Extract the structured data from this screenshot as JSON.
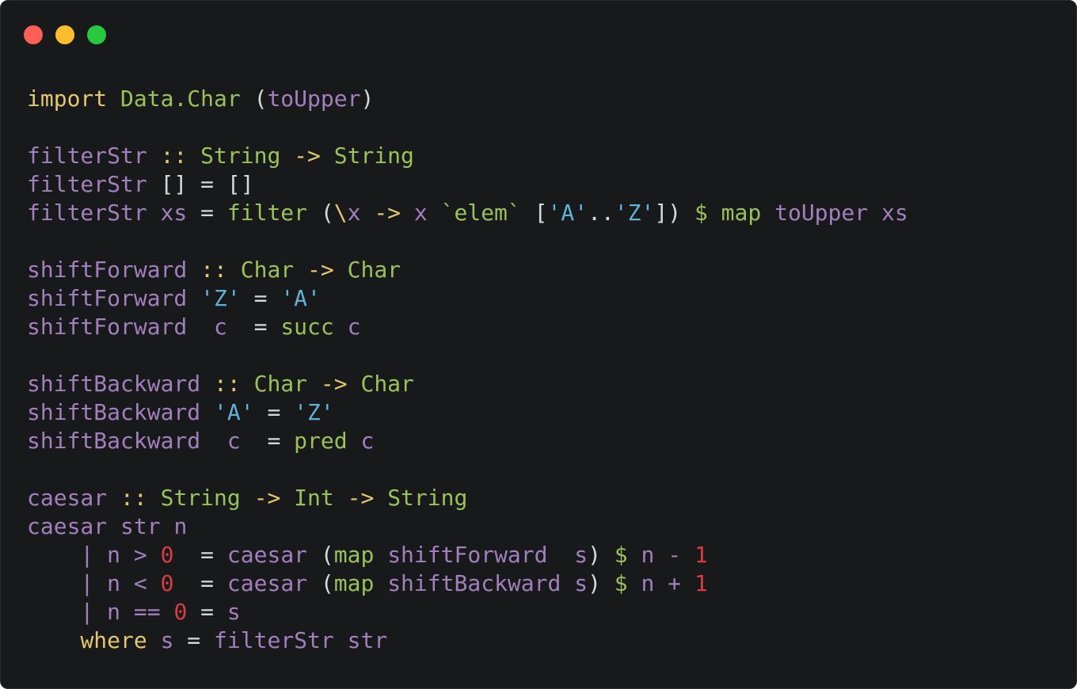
{
  "window": {
    "controls": [
      "close",
      "minimize",
      "maximize"
    ],
    "colors": {
      "background": "#18191b",
      "close": "#ff5f56",
      "minimize": "#ffbd2e",
      "maximize": "#27c93f"
    }
  },
  "syntax_colors": {
    "text": "#d8d8d8",
    "function": "#a27fbd",
    "type": "#9bc15a",
    "keyword": "#e5c770",
    "string": "#5fb3d6",
    "number": "#d83c44"
  },
  "code": {
    "language": "haskell",
    "lines": [
      [
        [
          "kw",
          "import"
        ],
        [
          "text",
          " "
        ],
        [
          "type",
          "Data.Char"
        ],
        [
          "text",
          " ("
        ],
        [
          "fn",
          "toUpper"
        ],
        [
          "text",
          ")"
        ]
      ],
      [],
      [
        [
          "fn",
          "filterStr"
        ],
        [
          "text",
          " "
        ],
        [
          "sym",
          "::"
        ],
        [
          "text",
          " "
        ],
        [
          "type",
          "String"
        ],
        [
          "text",
          " "
        ],
        [
          "sym",
          "->"
        ],
        [
          "text",
          " "
        ],
        [
          "type",
          "String"
        ]
      ],
      [
        [
          "fn",
          "filterStr"
        ],
        [
          "text",
          " [] = []"
        ]
      ],
      [
        [
          "fn",
          "filterStr"
        ],
        [
          "text",
          " "
        ],
        [
          "fn",
          "xs"
        ],
        [
          "text",
          " = "
        ],
        [
          "builtin",
          "filter"
        ],
        [
          "text",
          " ("
        ],
        [
          "sym",
          "\\"
        ],
        [
          "fn",
          "x"
        ],
        [
          "text",
          " "
        ],
        [
          "sym",
          "->"
        ],
        [
          "text",
          " "
        ],
        [
          "fn",
          "x"
        ],
        [
          "text",
          " "
        ],
        [
          "builtin",
          "`elem`"
        ],
        [
          "text",
          " ["
        ],
        [
          "str",
          "'A'"
        ],
        [
          "text",
          ".."
        ],
        [
          "str",
          "'Z'"
        ],
        [
          "text",
          "]) "
        ],
        [
          "builtin",
          "$"
        ],
        [
          "text",
          " "
        ],
        [
          "builtin",
          "map"
        ],
        [
          "text",
          " "
        ],
        [
          "fn",
          "toUpper"
        ],
        [
          "text",
          " "
        ],
        [
          "fn",
          "xs"
        ]
      ],
      [],
      [
        [
          "fn",
          "shiftForward"
        ],
        [
          "text",
          " "
        ],
        [
          "sym",
          "::"
        ],
        [
          "text",
          " "
        ],
        [
          "type",
          "Char"
        ],
        [
          "text",
          " "
        ],
        [
          "sym",
          "->"
        ],
        [
          "text",
          " "
        ],
        [
          "type",
          "Char"
        ]
      ],
      [
        [
          "fn",
          "shiftForward"
        ],
        [
          "text",
          " "
        ],
        [
          "str",
          "'Z'"
        ],
        [
          "text",
          " = "
        ],
        [
          "str",
          "'A'"
        ]
      ],
      [
        [
          "fn",
          "shiftForward"
        ],
        [
          "text",
          "  "
        ],
        [
          "fn",
          "c"
        ],
        [
          "text",
          "  = "
        ],
        [
          "builtin",
          "succ"
        ],
        [
          "text",
          " "
        ],
        [
          "fn",
          "c"
        ]
      ],
      [],
      [
        [
          "fn",
          "shiftBackward"
        ],
        [
          "text",
          " "
        ],
        [
          "sym",
          "::"
        ],
        [
          "text",
          " "
        ],
        [
          "type",
          "Char"
        ],
        [
          "text",
          " "
        ],
        [
          "sym",
          "->"
        ],
        [
          "text",
          " "
        ],
        [
          "type",
          "Char"
        ]
      ],
      [
        [
          "fn",
          "shiftBackward"
        ],
        [
          "text",
          " "
        ],
        [
          "str",
          "'A'"
        ],
        [
          "text",
          " = "
        ],
        [
          "str",
          "'Z'"
        ]
      ],
      [
        [
          "fn",
          "shiftBackward"
        ],
        [
          "text",
          "  "
        ],
        [
          "fn",
          "c"
        ],
        [
          "text",
          "  = "
        ],
        [
          "builtin",
          "pred"
        ],
        [
          "text",
          " "
        ],
        [
          "fn",
          "c"
        ]
      ],
      [],
      [
        [
          "fn",
          "caesar"
        ],
        [
          "text",
          " "
        ],
        [
          "sym",
          "::"
        ],
        [
          "text",
          " "
        ],
        [
          "type",
          "String"
        ],
        [
          "text",
          " "
        ],
        [
          "sym",
          "->"
        ],
        [
          "text",
          " "
        ],
        [
          "type",
          "Int"
        ],
        [
          "text",
          " "
        ],
        [
          "sym",
          "->"
        ],
        [
          "text",
          " "
        ],
        [
          "type",
          "String"
        ]
      ],
      [
        [
          "fn",
          "caesar"
        ],
        [
          "text",
          " "
        ],
        [
          "fn",
          "str"
        ],
        [
          "text",
          " "
        ],
        [
          "fn",
          "n"
        ]
      ],
      [
        [
          "text",
          "    "
        ],
        [
          "pipe",
          "|"
        ],
        [
          "text",
          " "
        ],
        [
          "fn",
          "n"
        ],
        [
          "text",
          " "
        ],
        [
          "fn",
          ">"
        ],
        [
          "text",
          " "
        ],
        [
          "num",
          "0"
        ],
        [
          "text",
          "  = "
        ],
        [
          "fn",
          "caesar"
        ],
        [
          "text",
          " ("
        ],
        [
          "builtin",
          "map"
        ],
        [
          "text",
          " "
        ],
        [
          "fn",
          "shiftForward"
        ],
        [
          "text",
          "  "
        ],
        [
          "fn",
          "s"
        ],
        [
          "text",
          ") "
        ],
        [
          "builtin",
          "$"
        ],
        [
          "text",
          " "
        ],
        [
          "fn",
          "n"
        ],
        [
          "text",
          " "
        ],
        [
          "fn",
          "-"
        ],
        [
          "text",
          " "
        ],
        [
          "num",
          "1"
        ]
      ],
      [
        [
          "text",
          "    "
        ],
        [
          "pipe",
          "|"
        ],
        [
          "text",
          " "
        ],
        [
          "fn",
          "n"
        ],
        [
          "text",
          " "
        ],
        [
          "fn",
          "<"
        ],
        [
          "text",
          " "
        ],
        [
          "num",
          "0"
        ],
        [
          "text",
          "  = "
        ],
        [
          "fn",
          "caesar"
        ],
        [
          "text",
          " ("
        ],
        [
          "builtin",
          "map"
        ],
        [
          "text",
          " "
        ],
        [
          "fn",
          "shiftBackward"
        ],
        [
          "text",
          " "
        ],
        [
          "fn",
          "s"
        ],
        [
          "text",
          ") "
        ],
        [
          "builtin",
          "$"
        ],
        [
          "text",
          " "
        ],
        [
          "fn",
          "n"
        ],
        [
          "text",
          " "
        ],
        [
          "fn",
          "+"
        ],
        [
          "text",
          " "
        ],
        [
          "num",
          "1"
        ]
      ],
      [
        [
          "text",
          "    "
        ],
        [
          "pipe",
          "|"
        ],
        [
          "text",
          " "
        ],
        [
          "fn",
          "n"
        ],
        [
          "text",
          " "
        ],
        [
          "fn",
          "=="
        ],
        [
          "text",
          " "
        ],
        [
          "num",
          "0"
        ],
        [
          "text",
          " = "
        ],
        [
          "fn",
          "s"
        ]
      ],
      [
        [
          "text",
          "    "
        ],
        [
          "kw",
          "where"
        ],
        [
          "text",
          " "
        ],
        [
          "fn",
          "s"
        ],
        [
          "text",
          " = "
        ],
        [
          "fn",
          "filterStr"
        ],
        [
          "text",
          " "
        ],
        [
          "fn",
          "str"
        ]
      ]
    ]
  }
}
